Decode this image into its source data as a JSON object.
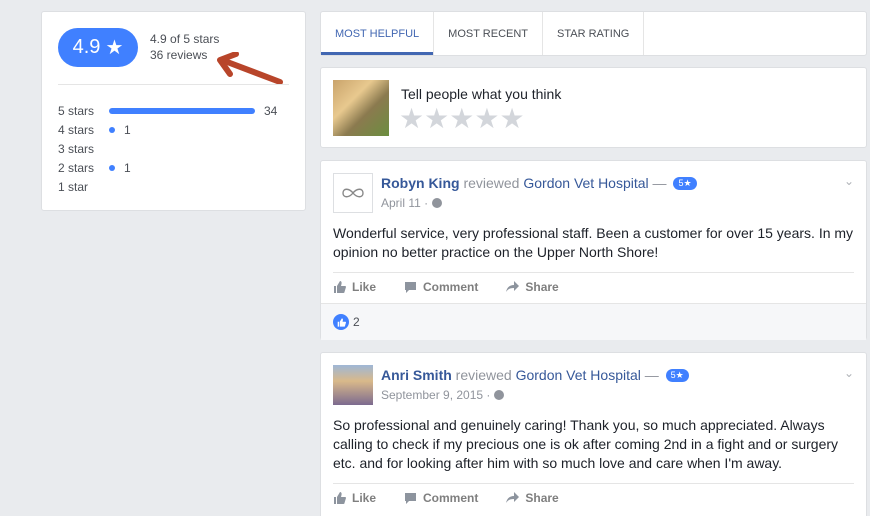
{
  "summary": {
    "rating": "4.9",
    "stars_of": "4.9 of 5 stars",
    "reviews": "36 reviews",
    "distribution": [
      {
        "label": "5 stars",
        "count": "34",
        "fraction": 1.0
      },
      {
        "label": "4 stars",
        "count": "1",
        "fraction": 0.03
      },
      {
        "label": "3 stars",
        "count": "",
        "fraction": 0
      },
      {
        "label": "2 stars",
        "count": "1",
        "fraction": 0.03
      },
      {
        "label": "1 star",
        "count": "",
        "fraction": 0
      }
    ],
    "accent": "#4080ff",
    "arrow_color": "#b8452a"
  },
  "tabs": [
    "MOST HELPFUL",
    "MOST RECENT",
    "STAR RATING"
  ],
  "composer": {
    "prompt": "Tell people what you think"
  },
  "reviews": [
    {
      "name": "Robyn King",
      "verb": "reviewed",
      "page": "Gordon Vet Hospital",
      "dash": "—",
      "badge": "5★",
      "date": "April 11 ·",
      "body": "Wonderful service, very professional staff. Been a customer for over 15 years. In my opinion no better practice on the Upper North Shore!",
      "likes": "2"
    },
    {
      "name": "Anri Smith",
      "verb": "reviewed",
      "page": "Gordon Vet Hospital",
      "dash": "—",
      "badge": "5★",
      "date": "September 9, 2015 ·",
      "body": "So professional and genuinely caring! Thank you, so much appreciated. Always calling to check if my precious one is ok after coming 2nd in a fight and or surgery etc. and for looking after him with so much love and care when I'm away."
    }
  ],
  "actions": {
    "like": "Like",
    "comment": "Comment",
    "share": "Share"
  }
}
